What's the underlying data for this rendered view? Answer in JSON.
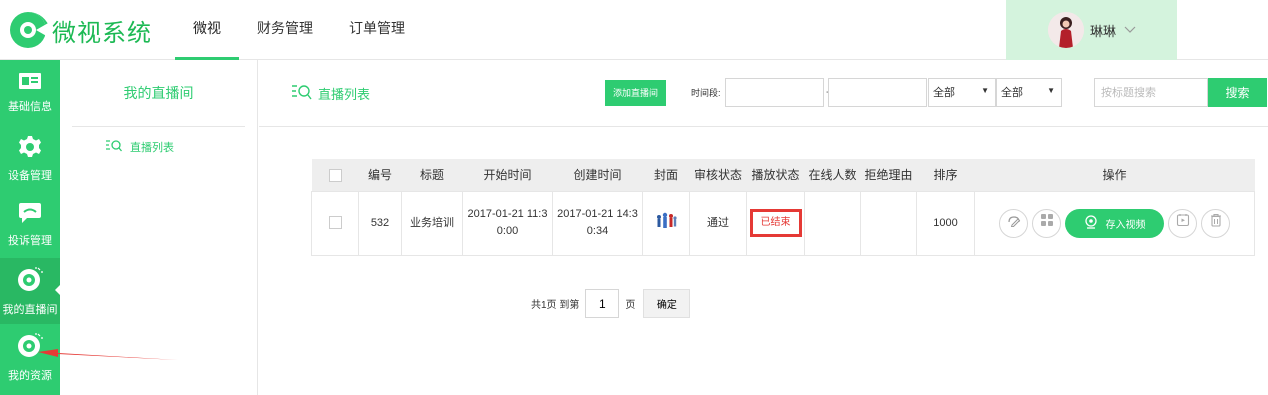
{
  "app": {
    "name": "微视系统"
  },
  "colors": {
    "accent": "#2ecc71",
    "sidebar_active": "#29b863",
    "user_bg": "#d4f3dd",
    "status_red": "#e53935"
  },
  "top_nav": [
    {
      "label": "微视",
      "active": true
    },
    {
      "label": "财务管理",
      "active": false
    },
    {
      "label": "订单管理",
      "active": false
    }
  ],
  "user": {
    "name": "琳琳"
  },
  "sidebar": [
    {
      "label": "基础信息",
      "icon": "id-card-icon"
    },
    {
      "label": "设备管理",
      "icon": "gear-icon"
    },
    {
      "label": "投诉管理",
      "icon": "message-icon"
    },
    {
      "label": "我的直播间",
      "icon": "live-room-icon",
      "active": true
    },
    {
      "label": "我的资源",
      "icon": "resource-icon"
    }
  ],
  "submenu": {
    "title": "我的直播间",
    "items": [
      {
        "label": "直播列表"
      }
    ]
  },
  "toolbar": {
    "title": "直播列表",
    "add_label": "添加直播间",
    "time_label": "时间段:",
    "date_separator": "-",
    "start_date": "",
    "end_date": "",
    "select1": "全部",
    "select2": "全部",
    "search_placeholder": "按标题搜索",
    "search_label": "搜索"
  },
  "table": {
    "headers": [
      "",
      "编号",
      "标题",
      "开始时间",
      "创建时间",
      "封面",
      "审核状态",
      "播放状态",
      "在线人数",
      "拒绝理由",
      "排序",
      "操作"
    ],
    "rows": [
      {
        "id": "532",
        "title": "业务培训",
        "start_time_line1": "2017-01-21 11:3",
        "start_time_line2": "0:00",
        "create_time_line1": "2017-01-21 14:3",
        "create_time_line2": "0:34",
        "review_status": "通过",
        "play_status": "已结束",
        "online_count": "",
        "reject_reason": "",
        "sort": "1000",
        "save_label": "存入视频"
      }
    ]
  },
  "pager": {
    "prefix": "共1页 到第",
    "page": "1",
    "suffix": "页",
    "ok_label": "确定"
  }
}
